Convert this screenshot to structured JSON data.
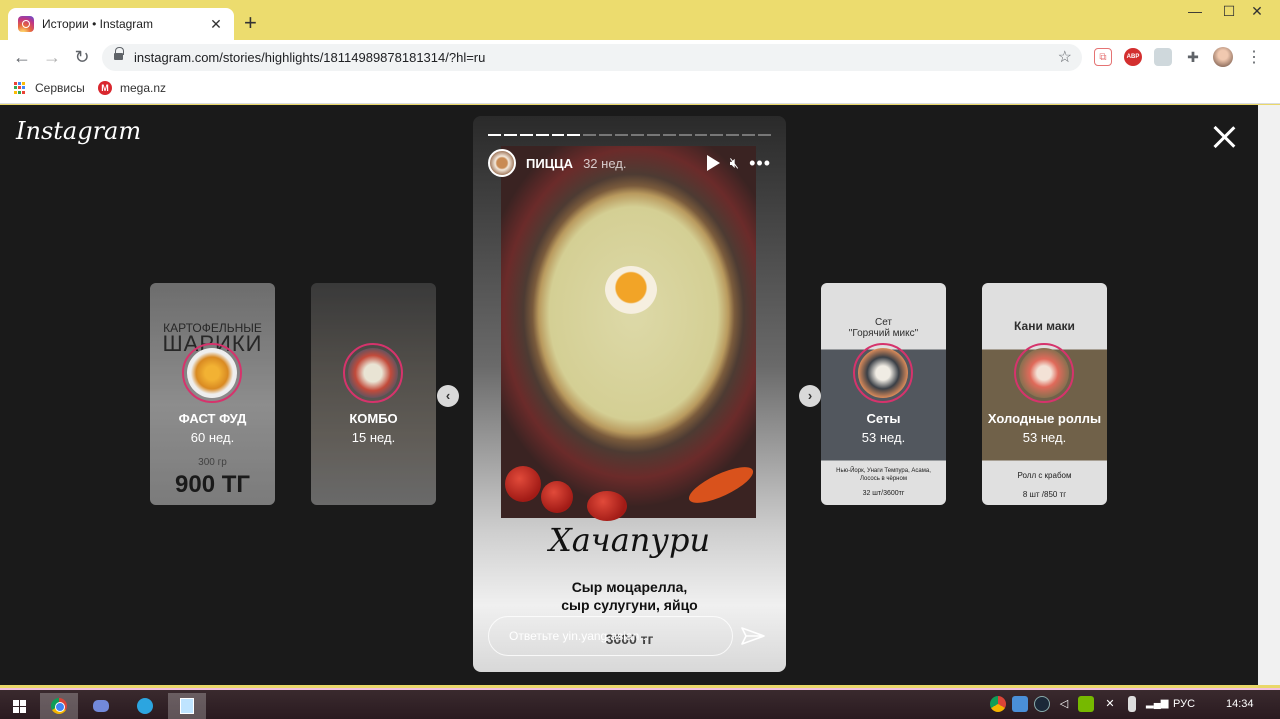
{
  "browser": {
    "tab_title": "Истории • Instagram",
    "tab_close": "✕",
    "new_tab": "+",
    "url": "instagram.com/stories/highlights/18114989878181314/?hl=ru",
    "bookmarks": [
      {
        "label": "Сервисы"
      },
      {
        "label": "mega.nz"
      }
    ],
    "extension_abp": "ABP"
  },
  "viewer": {
    "logo": "Instagram",
    "left_highlights": [
      {
        "name": "ФАСТ ФУД",
        "age": "60 нед.",
        "bg_top": "КАРТОФЕЛЬНЫЕ",
        "bg_big": "ШАРИКИ",
        "bg_small": "300 гр",
        "bg_price": "900 ТГ"
      },
      {
        "name": "КОМБО",
        "age": "15 нед."
      }
    ],
    "right_highlights": [
      {
        "name": "Сеты",
        "age": "53 нед.",
        "bg_top": "Сет\n\"Горячий микс\"",
        "bg_footer": "Нью-Йорк, Унаги Темпура, Асама, Лосось в чёрном",
        "bg_price": "32 шт/3600тг"
      },
      {
        "name": "Холодные роллы",
        "age": "53 нед.",
        "bg_top": "Кани маки",
        "bg_footer": "Ролл с крабом",
        "bg_price": "8 шт /850 тг"
      }
    ],
    "story": {
      "username": "ПИЦЦА",
      "time": "32 нед.",
      "script_title": "Хачапури",
      "desc_line1": "Сыр моцарелла,",
      "desc_line2": "сыр сулугуни, яйцо",
      "price": "3600 тг",
      "reply_placeholder": "Ответьте yin.yang.asian..."
    }
  },
  "taskbar": {
    "lang": "РУС",
    "clock": "14:34"
  },
  "colors": {
    "titlebar": "#ecdc6e",
    "viewer_bg": "#1a1a1a",
    "ring": "#d6336c"
  }
}
